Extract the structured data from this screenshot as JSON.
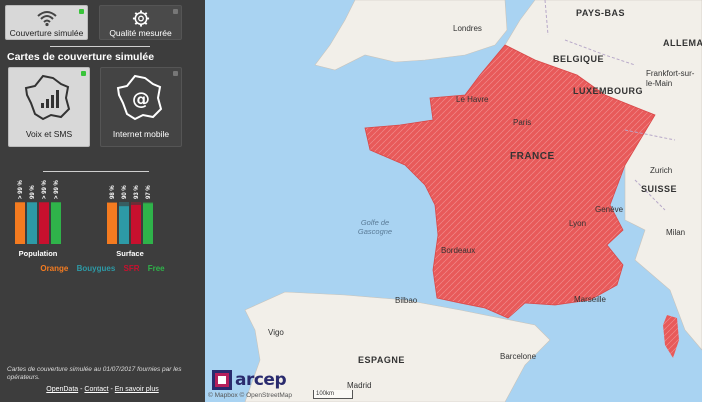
{
  "top_buttons": [
    {
      "label": "Couverture simulée",
      "active": true,
      "icon": "wifi-icon"
    },
    {
      "label": "Qualité mesurée",
      "active": false,
      "icon": "gear-icon"
    }
  ],
  "section_title": "Cartes de couverture simulée",
  "coverage_buttons": [
    {
      "label": "Voix et SMS",
      "active": true,
      "icon": "signal-bars-icon"
    },
    {
      "label": "Internet mobile",
      "active": false,
      "icon": "at-sign-icon"
    }
  ],
  "chart_data": {
    "type": "bar",
    "groups": [
      "Population",
      "Surface"
    ],
    "series": [
      {
        "name": "Orange",
        "color": "#f47b20",
        "values": [
          99,
          98
        ]
      },
      {
        "name": "Bouygues",
        "color": "#2d9aa6",
        "values": [
          99,
          90
        ]
      },
      {
        "name": "SFR",
        "color": "#c8102e",
        "values": [
          99,
          93
        ]
      },
      {
        "name": "Free",
        "color": "#2fb34a",
        "values": [
          99,
          97
        ]
      }
    ],
    "value_labels": [
      [
        "> 99 %",
        "99 %",
        "> 99 %",
        "> 99 %"
      ],
      [
        "98 %",
        "90 %",
        "93 %",
        "97 %"
      ]
    ],
    "ylim": [
      0,
      100
    ]
  },
  "footnote": "Cartes de couverture simulée au 01/07/2017 fournies par les opérateurs.",
  "links": {
    "opendata": "OpenData",
    "contact": "Contact",
    "more": "En savoir plus",
    "sep": " - "
  },
  "map": {
    "labels": [
      {
        "text": "PAYS-BAS",
        "type": "country"
      },
      {
        "text": "ALLEMA",
        "type": "country"
      },
      {
        "text": "Londres",
        "type": "city"
      },
      {
        "text": "BELGIQUE",
        "type": "country"
      },
      {
        "text": "LUXEMBOURG",
        "type": "country"
      },
      {
        "text": "Frankfort-sur-le-Main",
        "type": "city"
      },
      {
        "text": "Le Havre",
        "type": "city"
      },
      {
        "text": "Paris",
        "type": "city"
      },
      {
        "text": "FRANCE",
        "type": "country"
      },
      {
        "text": "Zurich",
        "type": "city"
      },
      {
        "text": "SUISSE",
        "type": "country"
      },
      {
        "text": "Genève",
        "type": "city"
      },
      {
        "text": "Golfe de Gascogne",
        "type": "sea"
      },
      {
        "text": "Lyon",
        "type": "city"
      },
      {
        "text": "Milan",
        "type": "city"
      },
      {
        "text": "Bordeaux",
        "type": "city"
      },
      {
        "text": "Bilbao",
        "type": "city"
      },
      {
        "text": "Marseille",
        "type": "city"
      },
      {
        "text": "Vigo",
        "type": "city"
      },
      {
        "text": "ESPAGNE",
        "type": "country"
      },
      {
        "text": "Barcelone",
        "type": "city"
      },
      {
        "text": "Madrid",
        "type": "city"
      }
    ],
    "logo_text": "arcep",
    "attribution": "© Mapbox © OpenStreetMap",
    "scale": "100km",
    "colors": {
      "sea": "#a9d3f2",
      "land": "#f2efe9",
      "coverage": "#e85a5a"
    }
  }
}
